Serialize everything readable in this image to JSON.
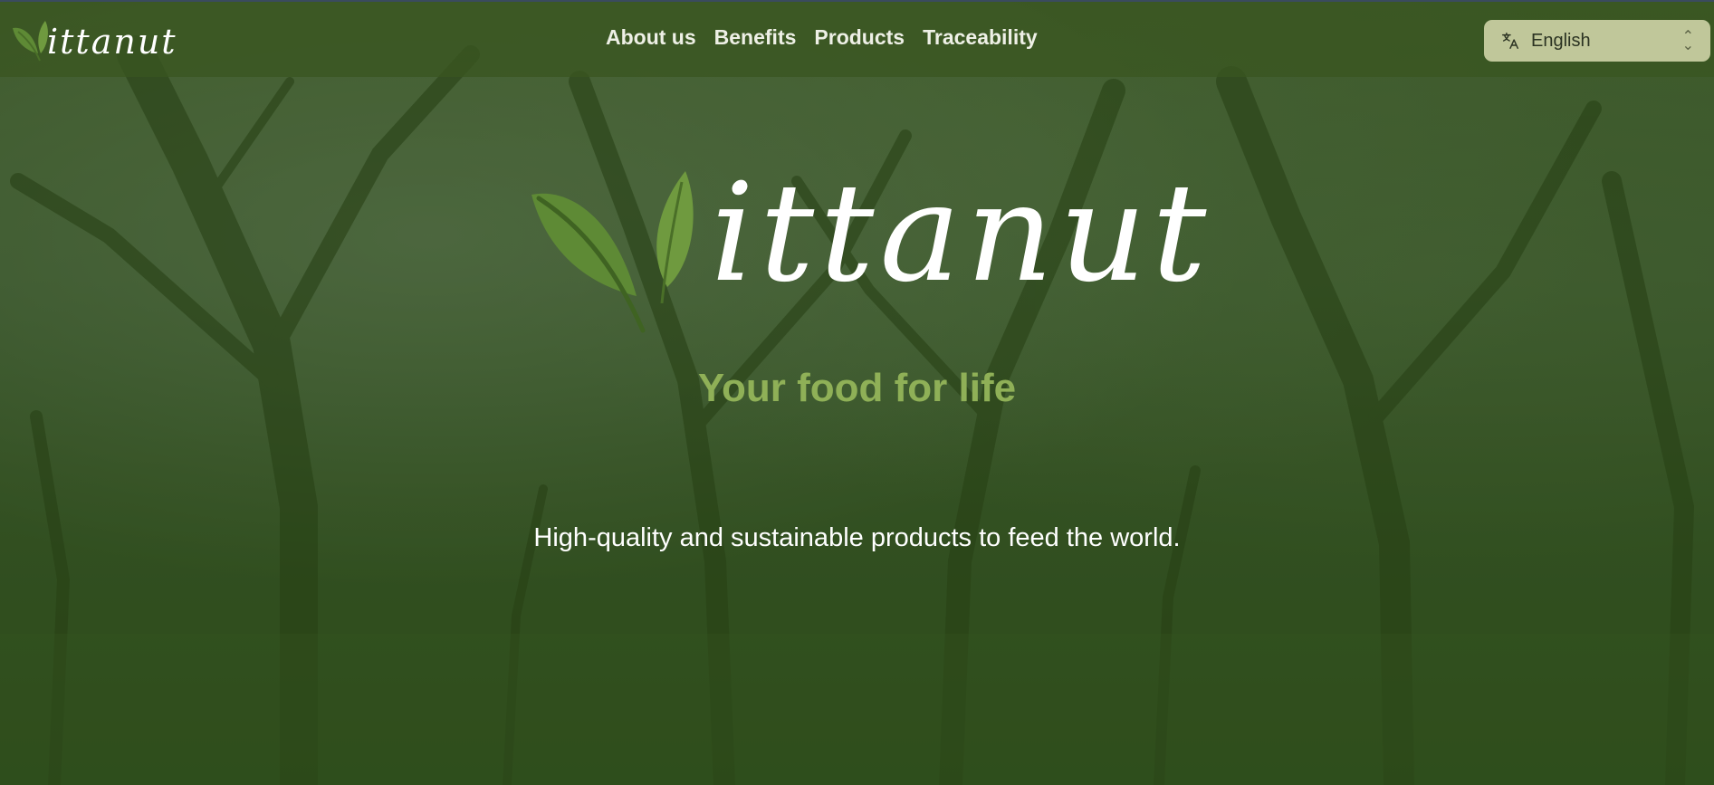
{
  "header": {
    "logo_text": "ittanut",
    "nav": [
      {
        "label": "About us"
      },
      {
        "label": "Benefits"
      },
      {
        "label": "Products"
      },
      {
        "label": "Traceability"
      }
    ],
    "language": {
      "icon": "translate-icon",
      "selected": "English"
    }
  },
  "hero": {
    "logo_text": "ittanut",
    "tagline": "Your food for life",
    "subtitle": "High-quality and sustainable products to feed the world."
  },
  "colors": {
    "accent_green": "#8fb057",
    "leaf_green": "#5e8a35",
    "language_button": "#c0c79a"
  }
}
